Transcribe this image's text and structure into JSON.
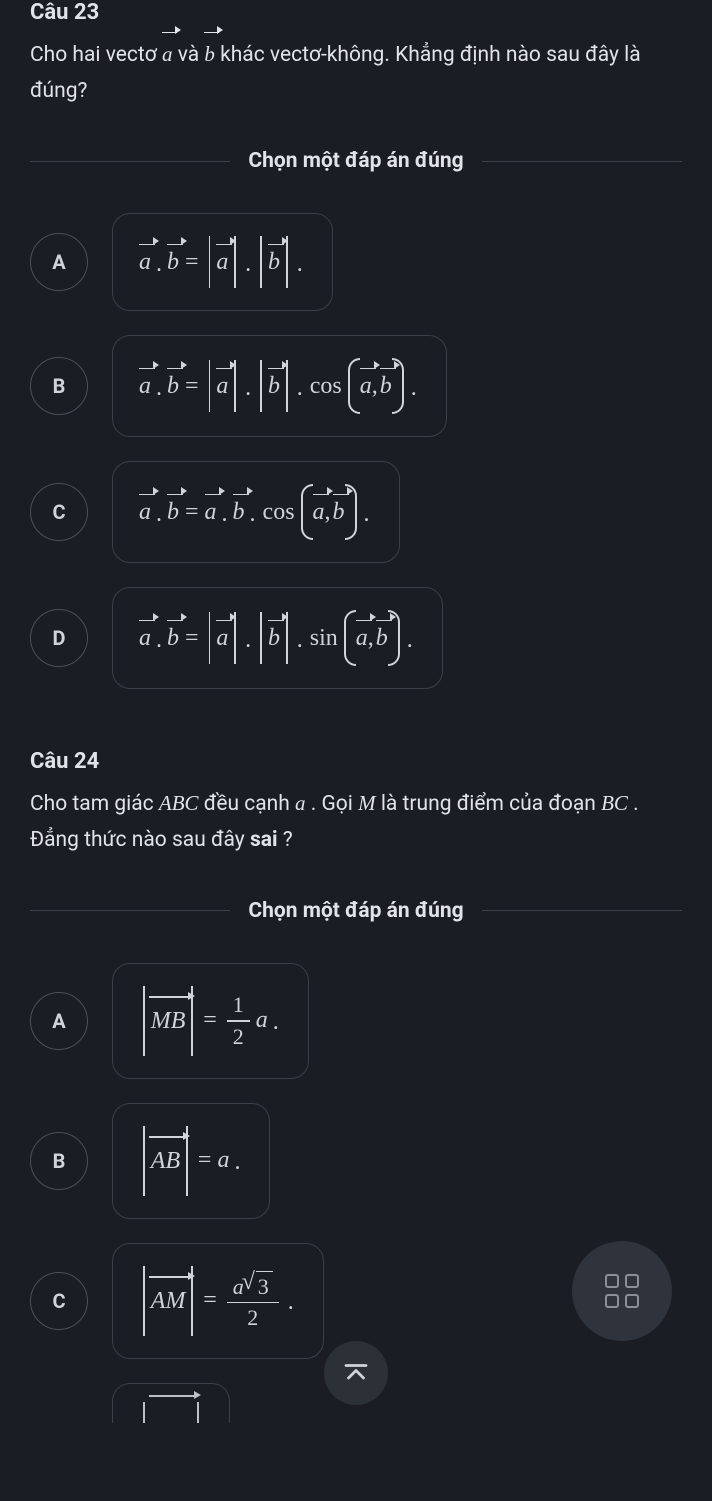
{
  "q23": {
    "num": "Câu 23",
    "text_pre": "Cho hai vectơ",
    "text_and": " và ",
    "text_post": "khác vectơ-không. Khẳng định nào sau đây là đúng?",
    "a_sym": "a",
    "b_sym": "b",
    "divider": "Chọn một đáp án đúng",
    "letters": {
      "A": "A",
      "B": "B",
      "C": "C",
      "D": "D"
    },
    "cos": "cos",
    "sin": "sin",
    "eq": "=",
    "dot": ".",
    "comma": ",",
    "period": "."
  },
  "q24": {
    "num": "Câu 24",
    "text_1": "Cho tam giác ",
    "ABC": "ABC",
    "text_2": " đều cạnh ",
    "a_sym": "a",
    "text_3": ". Gọi ",
    "M": "M",
    "text_4": " là trung điểm của đoạn ",
    "BC": "BC",
    "text_5": ". Đẳng thức nào sau đây ",
    "sai": "sai",
    "text_6": "?",
    "divider": "Chọn một đáp án đúng",
    "letters": {
      "A": "A",
      "B": "B",
      "C": "C"
    },
    "MB": "MB",
    "AB": "AB",
    "AM": "AM",
    "eq": "=",
    "one": "1",
    "two": "2",
    "three": "3",
    "period": "."
  }
}
